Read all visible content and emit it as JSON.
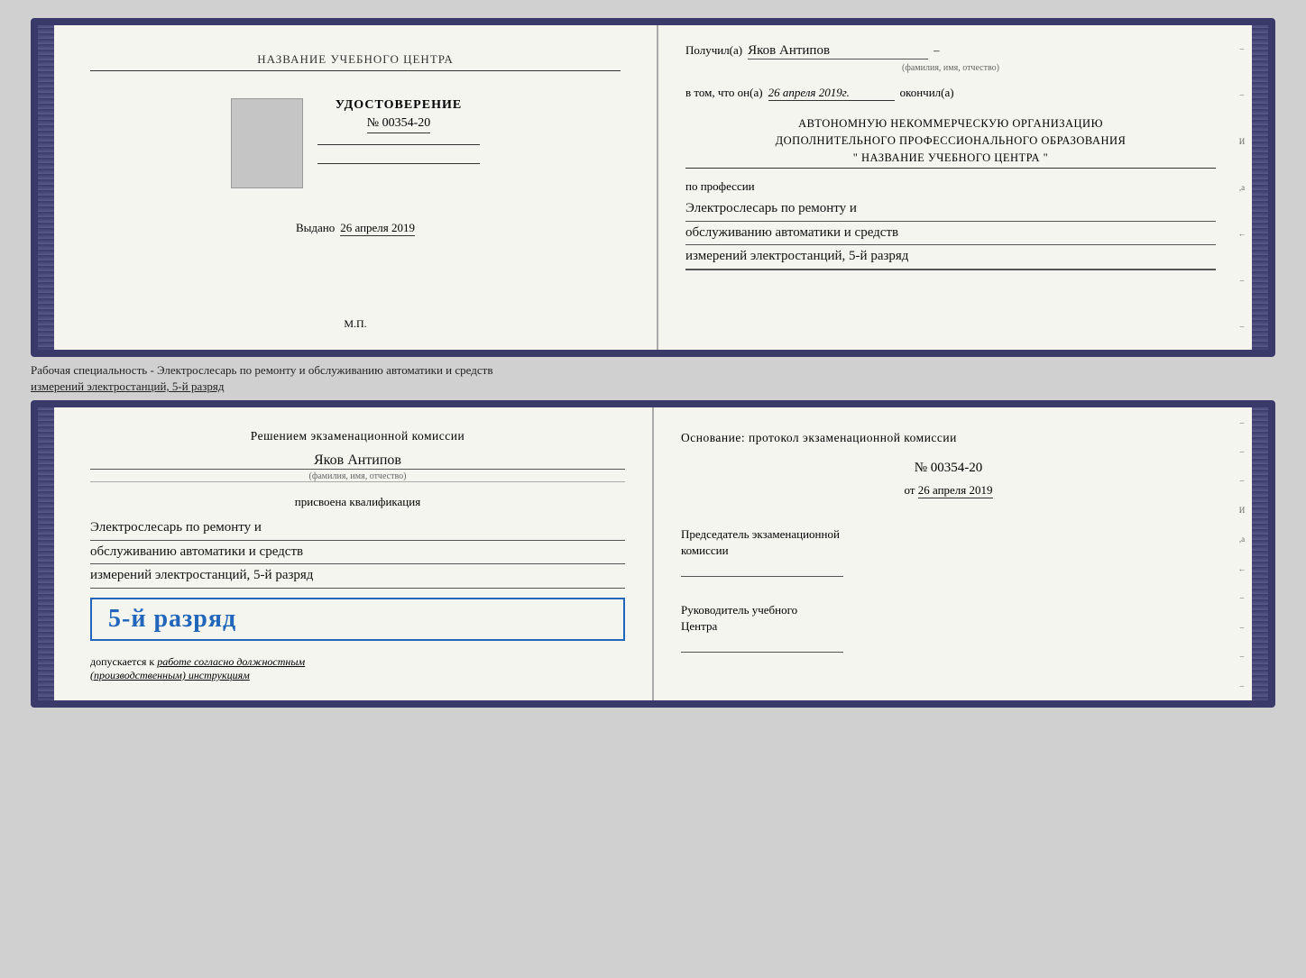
{
  "top_booklet": {
    "left_page": {
      "school_label": "НАЗВАНИЕ УЧЕБНОГО ЦЕНТРА",
      "cert_title": "УДОСТОВЕРЕНИЕ",
      "cert_number": "№ 00354-20",
      "issued_label": "Выдано",
      "issued_date": "26 апреля 2019",
      "stamp_label": "М.П."
    },
    "right_page": {
      "recipient_label": "Получил(а)",
      "recipient_name": "Яков Антипов",
      "recipient_dash": "–",
      "fio_hint": "(фамилия, имя, отчество)",
      "completed_label": "в том, что он(а)",
      "completed_date": "26 апреля 2019г.",
      "completed_end": "окончил(а)",
      "org_line1": "АВТОНОМНУЮ НЕКОММЕРЧЕСКУЮ ОРГАНИЗАЦИЮ",
      "org_line2": "ДОПОЛНИТЕЛЬНОГО ПРОФЕССИОНАЛЬНОГО ОБРАЗОВАНИЯ",
      "org_line3": "\"   НАЗВАНИЕ УЧЕБНОГО ЦЕНТРА   \"",
      "profession_label": "по профессии",
      "profession_line1": "Электрослесарь по ремонту и",
      "profession_line2": "обслуживанию автоматики и средств",
      "profession_line3": "измерений электростанций, 5-й разряд"
    }
  },
  "separator": {
    "text": "Рабочая специальность - Электрослесарь по ремонту и обслуживанию автоматики и средств",
    "text2": "измерений электростанций, 5-й разряд"
  },
  "bottom_booklet": {
    "left_page": {
      "commission_title": "Решением экзаменационной комиссии",
      "commission_name": "Яков Антипов",
      "fio_hint": "(фамилия, имя, отчество)",
      "qualification_label": "присвоена квалификация",
      "qual_line1": "Электрослесарь по ремонту и",
      "qual_line2": "обслуживанию автоматики и средств",
      "qual_line3": "измерений электростанций, 5-й разряд",
      "rank_badge": "5-й разряд",
      "allowed_prefix": "допускается к",
      "allowed_text": "работе согласно должностным",
      "allowed_text2": "(производственным) инструкциям"
    },
    "right_page": {
      "basis_label": "Основание: протокол экзаменационной комиссии",
      "protocol_number": "№  00354-20",
      "protocol_date_prefix": "от",
      "protocol_date": "26 апреля 2019",
      "chairman_title": "Председатель экзаменационной",
      "chairman_title2": "комиссии",
      "center_head_title": "Руководитель учебного",
      "center_head_title2": "Центра"
    }
  }
}
